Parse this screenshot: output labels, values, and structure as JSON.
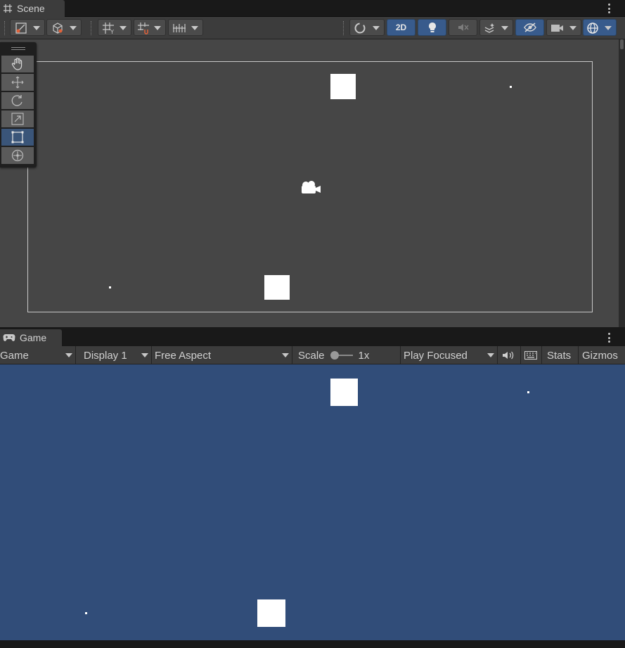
{
  "scene": {
    "tab_label": "Scene",
    "tab_icon": "grid-hash-icon",
    "toolbar": {
      "two_d_label": "2D",
      "icons": [
        "tool-handle-icon",
        "draw-mode-cube-icon",
        "grid-snap-icon",
        "increment-snap-icon",
        "align-icon",
        "orientation-gizmo-icon",
        "lighting-bulb-icon",
        "audio-mute-icon",
        "effects-layers-icon",
        "hidden-objects-icon",
        "camera-icon",
        "gizmos-globe-icon"
      ]
    },
    "tools": [
      "hand-tool-icon",
      "move-tool-icon",
      "rotate-tool-icon",
      "scale-tool-icon",
      "rect-tool-icon",
      "transform-tool-icon"
    ],
    "active_tool": "rect-tool-icon"
  },
  "game": {
    "tab_label": "Game",
    "tab_icon": "gamepad-icon",
    "toolbar": {
      "view_mode": "Game",
      "display": "Display 1",
      "aspect": "Free Aspect",
      "scale_label": "Scale",
      "scale_value": "1x",
      "play_mode": "Play Focused",
      "stats_label": "Stats",
      "gizmos_label": "Gizmos"
    }
  },
  "colors": {
    "editor_bg": "#3c3c3c",
    "scene_bg": "#464646",
    "game_bg": "#314d79",
    "active_blue": "#385b8c",
    "object_white": "#ffffff"
  }
}
